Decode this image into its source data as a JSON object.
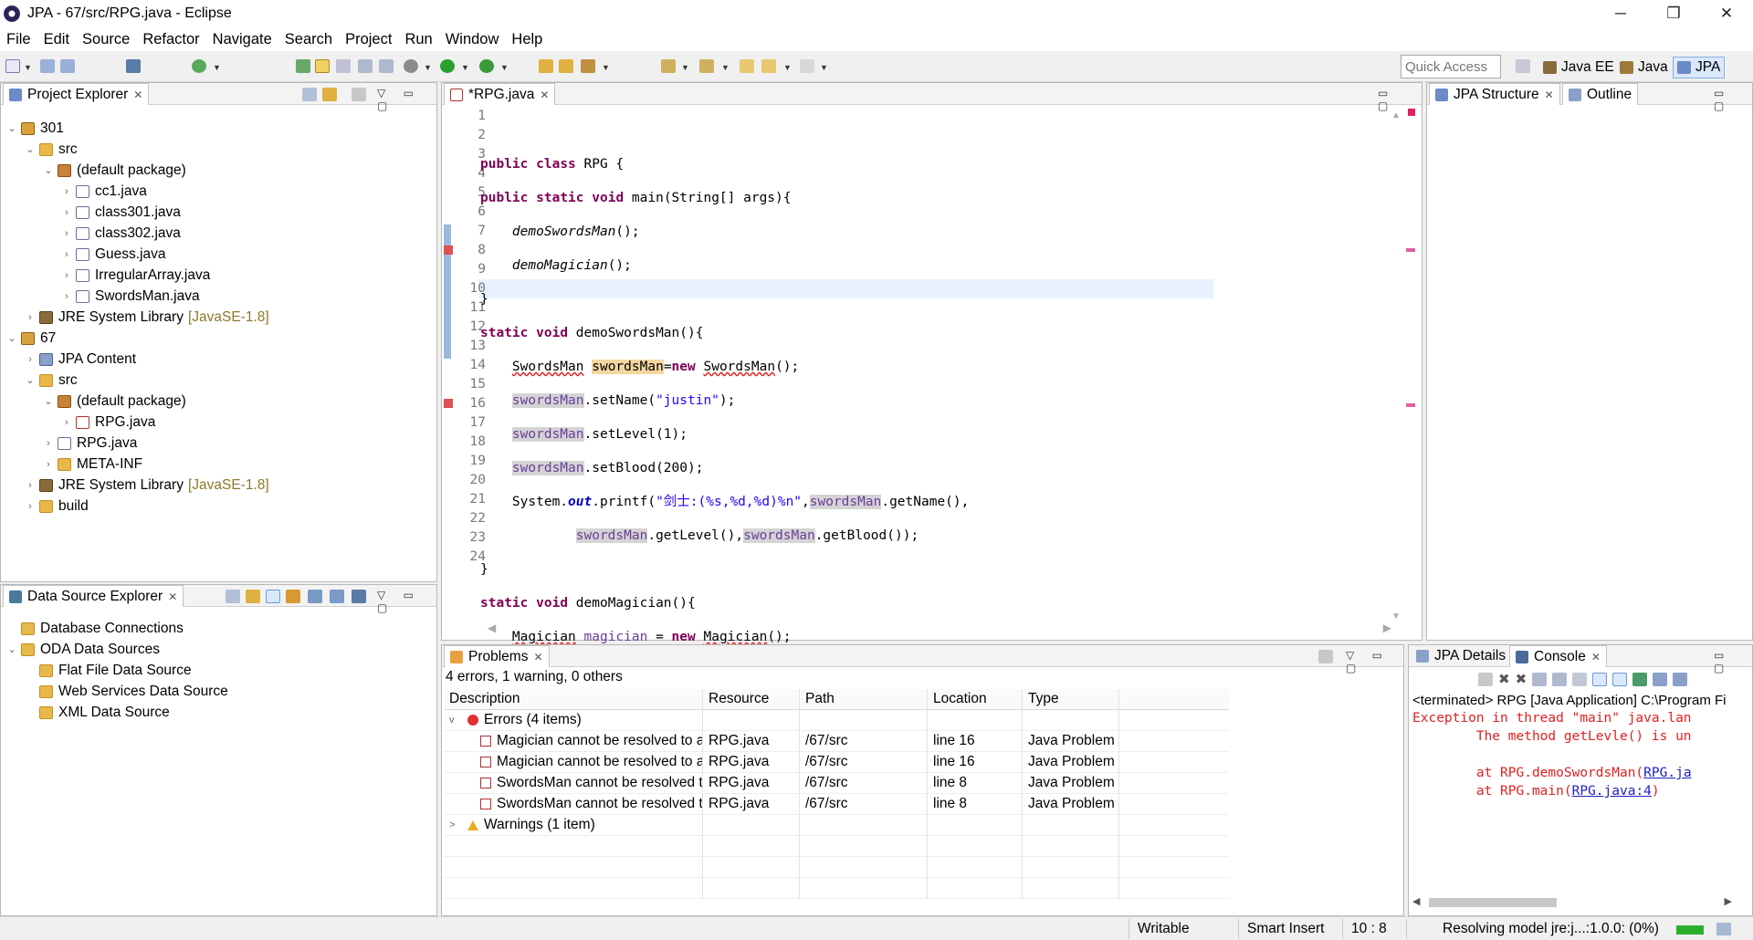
{
  "window": {
    "title": "JPA - 67/src/RPG.java - Eclipse",
    "minimize": "─",
    "restore": "❐",
    "close": "✕"
  },
  "menu": [
    "File",
    "Edit",
    "Source",
    "Refactor",
    "Navigate",
    "Search",
    "Project",
    "Run",
    "Window",
    "Help"
  ],
  "toolbar": {
    "quick_access_placeholder": "Quick Access",
    "perspectives": [
      "Java EE",
      "Java",
      "JPA"
    ],
    "active_perspective": "JPA"
  },
  "project_explorer": {
    "tab_label": "Project Explorer",
    "items": [
      {
        "label": "301",
        "twisty": "v",
        "icon": "project"
      },
      {
        "label": "src",
        "twisty": "v",
        "icon": "src-folder"
      },
      {
        "label": "(default package)",
        "twisty": "v",
        "icon": "package"
      },
      {
        "label": "cc1.java",
        "twisty": ">",
        "icon": "java-file"
      },
      {
        "label": "class301.java",
        "twisty": ">",
        "icon": "java-file"
      },
      {
        "label": "class302.java",
        "twisty": ">",
        "icon": "java-file"
      },
      {
        "label": "Guess.java",
        "twisty": ">",
        "icon": "java-file"
      },
      {
        "label": "IrregularArray.java",
        "twisty": ">",
        "icon": "java-file"
      },
      {
        "label": "SwordsMan.java",
        "twisty": ">",
        "icon": "java-file"
      },
      {
        "label": "JRE System Library",
        "version": "[JavaSE-1.8]",
        "twisty": ">",
        "icon": "library"
      },
      {
        "label": "67",
        "twisty": "v",
        "icon": "project-error"
      },
      {
        "label": "JPA Content",
        "twisty": ">",
        "icon": "jpa"
      },
      {
        "label": "src",
        "twisty": "v",
        "icon": "src-folder-error"
      },
      {
        "label": "(default package)",
        "twisty": "v",
        "icon": "package-error"
      },
      {
        "label": "RPG.java",
        "twisty": ">",
        "icon": "java-file-error"
      },
      {
        "label": "RPG.java",
        "twisty": ">",
        "icon": "java-file"
      },
      {
        "label": "META-INF",
        "twisty": ">",
        "icon": "folder"
      },
      {
        "label": "JRE System Library",
        "version": "[JavaSE-1.8]",
        "twisty": ">",
        "icon": "library"
      },
      {
        "label": "build",
        "twisty": ">",
        "icon": "folder"
      }
    ]
  },
  "data_source_explorer": {
    "tab_label": "Data Source Explorer",
    "items": [
      {
        "label": "Database Connections",
        "twisty": "",
        "icon": "folder"
      },
      {
        "label": "ODA Data Sources",
        "twisty": "v",
        "icon": "folder"
      },
      {
        "label": "Flat File Data Source",
        "twisty": "",
        "icon": "folder"
      },
      {
        "label": "Web Services Data Source",
        "twisty": "",
        "icon": "folder"
      },
      {
        "label": "XML Data Source",
        "twisty": "",
        "icon": "folder"
      }
    ]
  },
  "editor": {
    "tab_label": "*RPG.java",
    "line_numbers": [
      "1",
      "2",
      "3",
      "4",
      "5",
      "6",
      "7",
      "8",
      "9",
      "10",
      "11",
      "12",
      "13",
      "14",
      "15",
      "16",
      "17",
      "18",
      "19",
      "20",
      "21",
      "22",
      "23",
      "24"
    ],
    "cursor_line": "10"
  },
  "jpa_structure": {
    "tab_label": "JPA Structure",
    "outline_label": "Outline"
  },
  "problems": {
    "tab_label": "Problems",
    "summary": "4 errors, 1 warning, 0 others",
    "columns": [
      "Description",
      "Resource",
      "Path",
      "Location",
      "Type"
    ],
    "errors_group": "Errors (4 items)",
    "warnings_group": "Warnings (1 item)",
    "rows": [
      {
        "description": "Magician cannot be resolved to a type",
        "resource": "RPG.java",
        "path": "/67/src",
        "location": "line 16",
        "type": "Java Problem"
      },
      {
        "description": "Magician cannot be resolved to a type",
        "resource": "RPG.java",
        "path": "/67/src",
        "location": "line 16",
        "type": "Java Problem"
      },
      {
        "description": "SwordsMan cannot be resolved to a typ",
        "resource": "RPG.java",
        "path": "/67/src",
        "location": "line 8",
        "type": "Java Problem"
      },
      {
        "description": "SwordsMan cannot be resolved to a typ",
        "resource": "RPG.java",
        "path": "/67/src",
        "location": "line 8",
        "type": "Java Problem"
      }
    ]
  },
  "console": {
    "jpa_details_label": "JPA Details",
    "tab_label": "Console",
    "header": "<terminated> RPG [Java Application] C:\\Program Fi",
    "line1": "Exception in thread \"main\" java.lan",
    "line2": "        The method getLevle() is un",
    "line3_prefix": "        at RPG.demoSwordsMan(",
    "line3_link": "RPG.ja",
    "line4_prefix": "        at RPG.main(",
    "line4_link": "RPG.java:4",
    "line4_suffix": ")"
  },
  "status": {
    "writable": "Writable",
    "insert_mode": "Smart Insert",
    "position": "10 : 8",
    "progress_text": "Resolving model jre:j...:1.0.0: (0%)"
  },
  "colors": {
    "keyword": "#7f0055",
    "string": "#2a00ff",
    "error": "#e02020",
    "selection": "#d9e8fb"
  }
}
